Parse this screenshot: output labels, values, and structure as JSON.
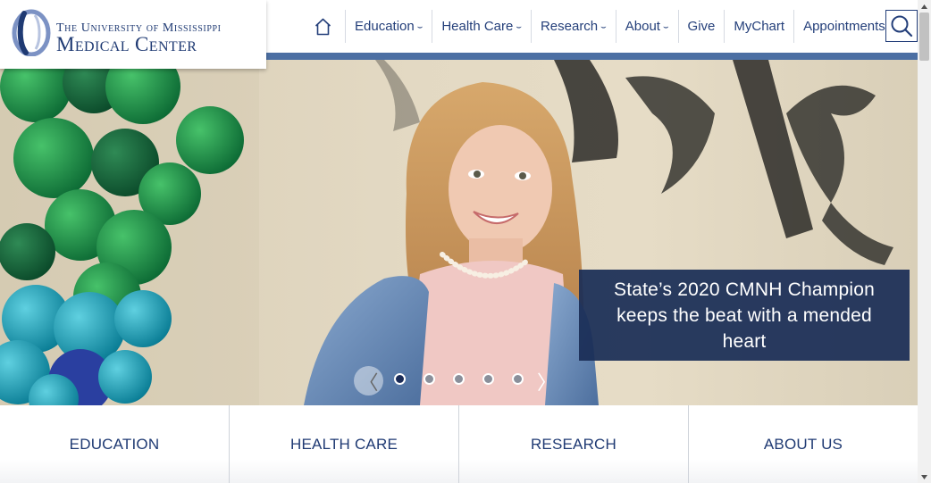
{
  "brand": {
    "line1": "The University of Mississippi",
    "line2": "Medical Center",
    "color": "#1f3a73"
  },
  "nav": {
    "home_icon": "home-icon",
    "items": [
      {
        "label": "Education",
        "has_dropdown": true
      },
      {
        "label": "Health Care",
        "has_dropdown": true
      },
      {
        "label": "Research",
        "has_dropdown": true
      },
      {
        "label": "About",
        "has_dropdown": true
      },
      {
        "label": "Give",
        "has_dropdown": false
      },
      {
        "label": "MyChart",
        "has_dropdown": false
      },
      {
        "label": "Appointments",
        "has_dropdown": false
      }
    ],
    "dropdown_icon": "chevron-down-icon",
    "search_icon": "search-icon"
  },
  "hero": {
    "caption": "State’s 2020 CMNH Champion keeps the beat with a mended heart",
    "prev_icon": "chevron-left-icon",
    "next_icon": "chevron-right-icon",
    "slide_count": 5,
    "active_slide": 1
  },
  "tiles": [
    {
      "label": "EDUCATION"
    },
    {
      "label": "HEALTH CARE"
    },
    {
      "label": "RESEARCH"
    },
    {
      "label": "ABOUT US"
    }
  ],
  "colors": {
    "accent": "#4c6fa3",
    "navy": "#1a2b57"
  }
}
